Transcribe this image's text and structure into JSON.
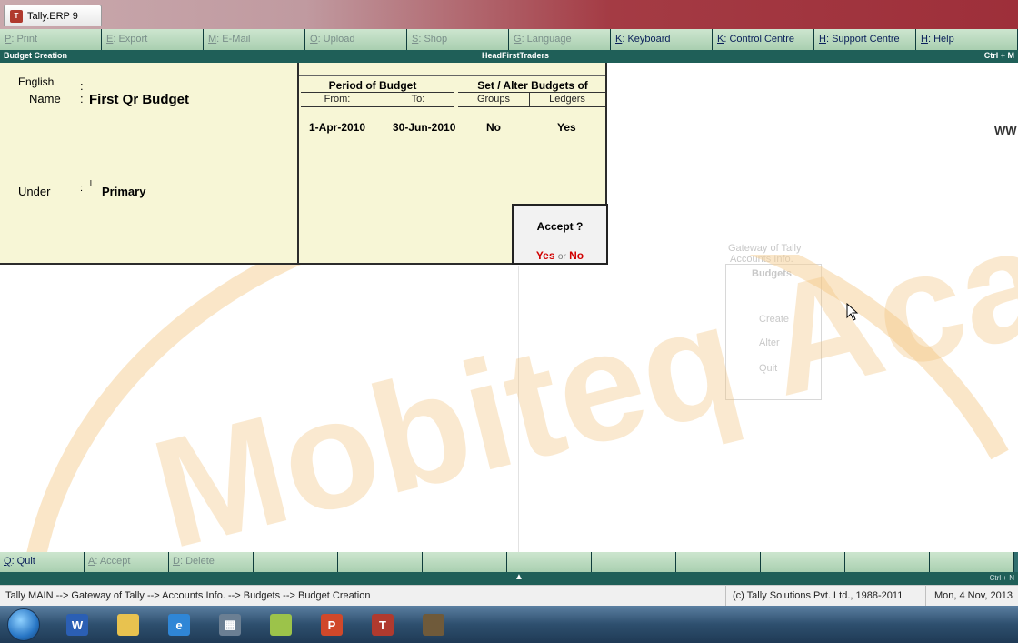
{
  "window": {
    "title": "Tally.ERP 9"
  },
  "topbar": {
    "buttons": [
      {
        "key": "P",
        "label": ": Print",
        "enabled": false
      },
      {
        "key": "E",
        "label": ": Export",
        "enabled": false
      },
      {
        "key": "M",
        "label": ": E-Mail",
        "enabled": false
      },
      {
        "key": "O",
        "label": ": Upload",
        "enabled": false
      },
      {
        "key": "S",
        "label": ": Shop",
        "enabled": false
      },
      {
        "key": "G",
        "label": ": Language",
        "enabled": false
      },
      {
        "key": "K",
        "label": ": Keyboard",
        "enabled": true
      },
      {
        "key": "K",
        "label": ": Control Centre",
        "enabled": true
      },
      {
        "key": "H",
        "label": ": Support Centre",
        "enabled": true
      },
      {
        "key": "H",
        "label": ": Help",
        "enabled": true
      }
    ]
  },
  "header": {
    "screen": "Budget Creation",
    "company": "HeadFirstTraders",
    "shortcut": "Ctrl + M"
  },
  "form": {
    "language_label": "English",
    "language_colon": ":",
    "name_label": "Name",
    "name_colon": ":",
    "name_value": "First Qr Budget",
    "under_label": "Under",
    "under_colon": ":",
    "under_marker": "┘",
    "under_value": "Primary",
    "period_header": "Period of Budget",
    "from_label": "From:",
    "to_label": "To:",
    "from_value": "1-Apr-2010",
    "to_value": "30-Jun-2010",
    "set_alter_header": "Set / Alter Budgets of",
    "groups_label": "Groups",
    "ledgers_label": "Ledgers",
    "groups_value": "No",
    "ledgers_value": "Yes"
  },
  "accept_dialog": {
    "title": "Accept ?",
    "yes": "Yes",
    "or": "or",
    "no": "No"
  },
  "right_panel": {
    "www_fragment": "WW",
    "ghost_menu": {
      "line1": "Gateway of Tally",
      "line2": "Accounts Info.",
      "title": "Budgets",
      "items": [
        "Create",
        "Alter",
        "Quit"
      ]
    }
  },
  "watermark_text": "Mobiteq Academy",
  "bottombar": {
    "buttons": [
      {
        "key": "Q",
        "label": ": Quit",
        "enabled": true
      },
      {
        "key": "A",
        "label": ": Accept",
        "enabled": false
      },
      {
        "key": "D",
        "label": ": Delete",
        "enabled": false
      }
    ],
    "empty_count": 9,
    "ctrl_n": "Ctrl + N"
  },
  "statusbar": {
    "breadcrumb": "Tally MAIN --> Gateway of Tally --> Accounts Info. --> Budgets --> Budget Creation",
    "copyright": "(c) Tally Solutions Pvt. Ltd., 1988-2011",
    "date": "Mon, 4 Nov, 2013"
  },
  "taskbar": {
    "items": [
      {
        "icon": "word-icon",
        "glyph": "W",
        "color": "#2b5fb4"
      },
      {
        "icon": "folder-icon",
        "glyph": "",
        "color": "#e8c24f"
      },
      {
        "icon": "internet-explorer-icon",
        "glyph": "e",
        "color": "#2f86d6"
      },
      {
        "icon": "calculator-icon",
        "glyph": "▦",
        "color": "#6b7f93"
      },
      {
        "icon": "notepad-icon",
        "glyph": "",
        "color": "#9cc34a"
      },
      {
        "icon": "powerpoint-icon",
        "glyph": "P",
        "color": "#d0482a"
      },
      {
        "icon": "tally-erp-icon",
        "glyph": "T",
        "color": "#b03a2e"
      },
      {
        "icon": "desktop-tool-icon",
        "glyph": "",
        "color": "#6f5a3a"
      }
    ]
  },
  "colors": {
    "form_bg": "#f7f6d6",
    "bar_bg": "#2f6e6e",
    "accent_red": "#d10000",
    "watermark": "#f2c27a"
  }
}
